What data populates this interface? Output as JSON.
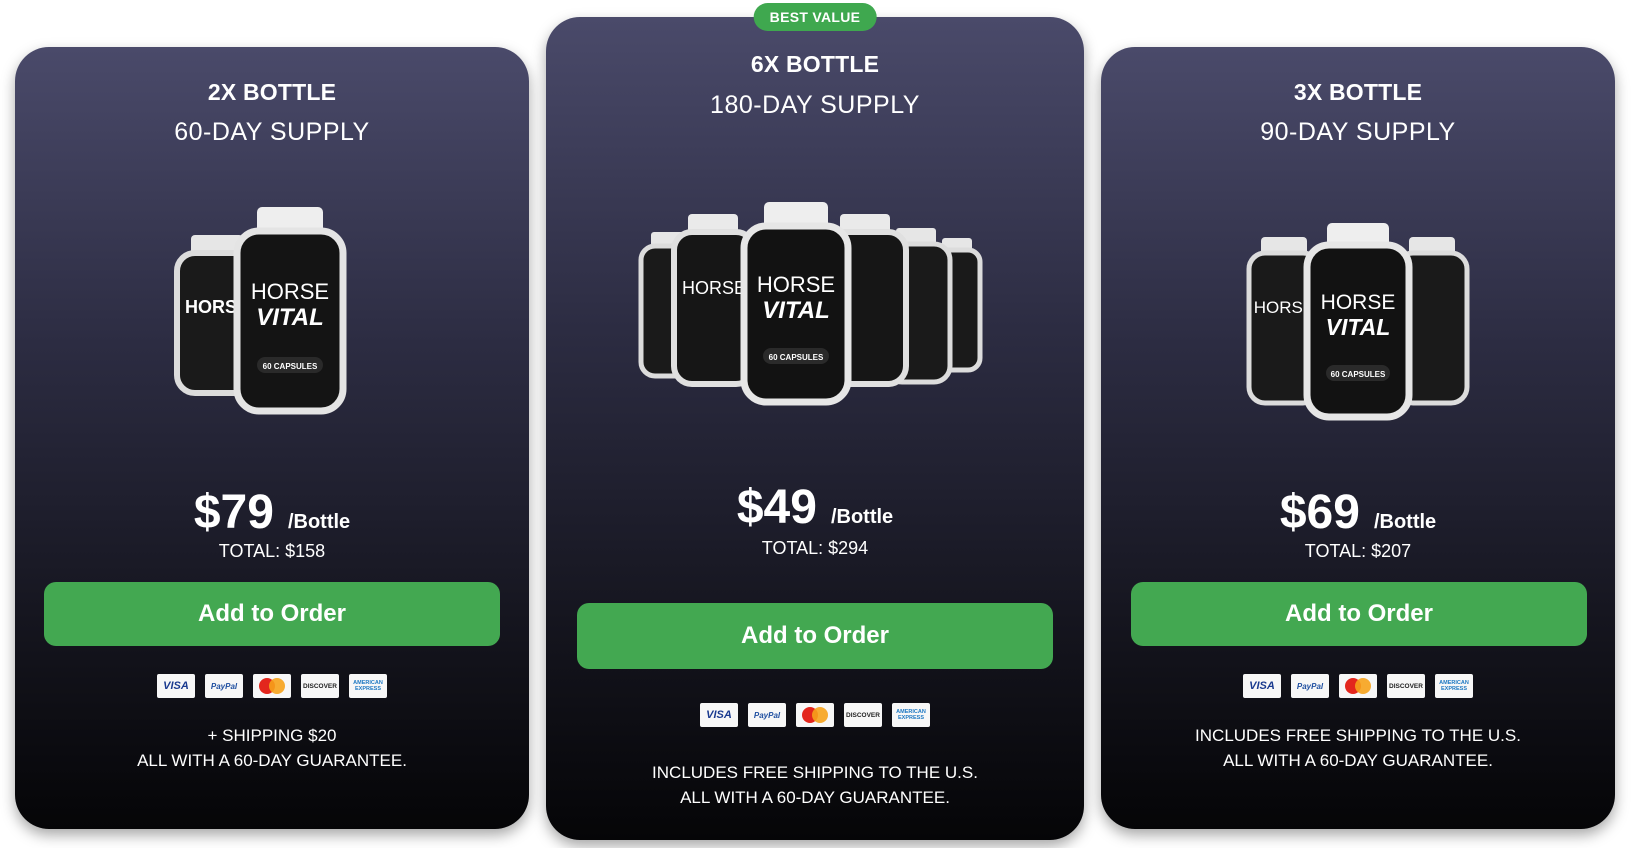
{
  "plans": [
    {
      "qty": "2X BOTTLE",
      "supply": "60-DAY SUPPLY",
      "price": "$79",
      "per": "/Bottle",
      "total": "TOTAL: $158",
      "button": "Add to Order",
      "note1": "+ SHIPPING $20",
      "note2": "ALL WITH A 60-DAY GUARANTEE.",
      "bottle_count": 2
    },
    {
      "badge": "BEST VALUE",
      "qty": "6X BOTTLE",
      "supply": "180-DAY SUPPLY",
      "price": "$49",
      "per": "/Bottle",
      "total": "TOTAL: $294",
      "button": "Add to Order",
      "note1": "INCLUDES FREE SHIPPING TO THE U.S.",
      "note2": "ALL WITH A 60-DAY GUARANTEE.",
      "bottle_count": 6
    },
    {
      "qty": "3X BOTTLE",
      "supply": "90-DAY SUPPLY",
      "price": "$69",
      "per": "/Bottle",
      "total": "TOTAL: $207",
      "button": "Add to Order",
      "note1": "INCLUDES FREE SHIPPING TO THE U.S.",
      "note2": "ALL WITH A 60-DAY GUARANTEE.",
      "bottle_count": 3
    }
  ],
  "product": {
    "brand_line1": "HORSE",
    "brand_line2": "VITAL",
    "capsules": "60 CAPSULES"
  },
  "payments": {
    "visa": "VISA",
    "paypal": "PayPal",
    "discover": "DISCOVER",
    "amex_line1": "AMERICAN",
    "amex_line2": "EXPRESS"
  },
  "colors": {
    "button": "#43a851",
    "badge": "#3fa84f",
    "card_top": "#4a4a6a",
    "card_bottom": "#050507"
  }
}
